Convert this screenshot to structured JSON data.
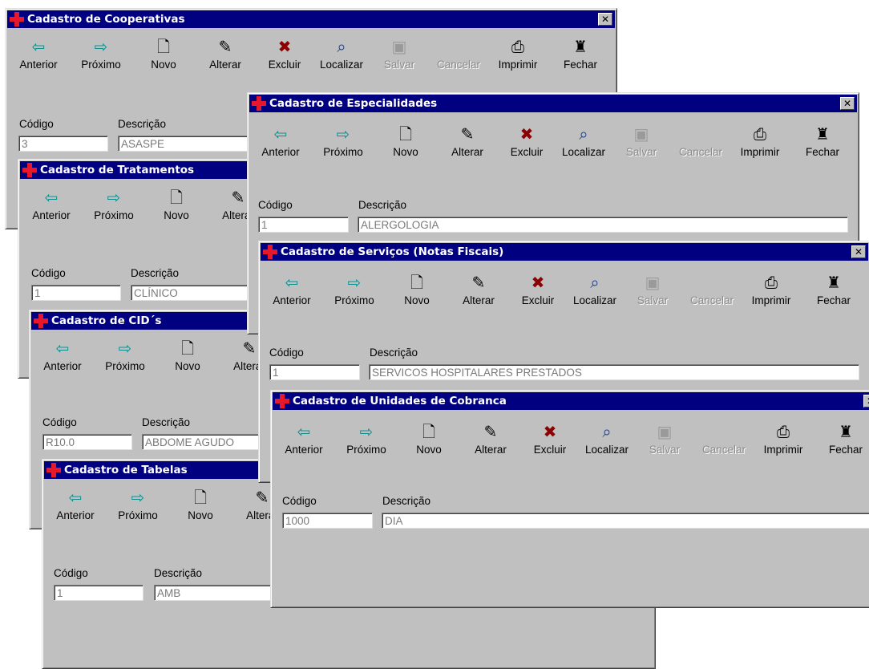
{
  "toolbar_labels": {
    "anterior": "Anterior",
    "proximo": "Próximo",
    "novo": "Novo",
    "alterar": "Alterar",
    "excluir": "Excluir",
    "localizar": "Localizar",
    "salvar": "Salvar",
    "cancelar": "Cancelar",
    "imprimir": "Imprimir",
    "fechar": "Fechar"
  },
  "field_labels": {
    "codigo": "Código",
    "descricao": "Descrição"
  },
  "close_glyph": "✕",
  "icons": {
    "anterior": "arrow-left-icon",
    "proximo": "arrow-right-icon",
    "novo": "new-document-icon",
    "alterar": "edit-icon",
    "excluir": "delete-x-icon",
    "localizar": "find-icon",
    "salvar": "save-disk-icon",
    "imprimir": "printer-icon",
    "fechar": "exit-door-icon"
  },
  "colors": {
    "titlebar": "#000080",
    "window": "#c0c0c0",
    "logo_cross": "#e8182c",
    "nav_arrow": "#0e8f8f"
  },
  "windows": {
    "cooperativas": {
      "title": "Cadastro de Cooperativas",
      "codigo": "3",
      "descricao": "ASASPE"
    },
    "tratamentos": {
      "title": "Cadastro de Tratamentos",
      "codigo": "1",
      "descricao": "CLÍNICO"
    },
    "cids": {
      "title": "Cadastro de CID´s",
      "codigo": "R10.0",
      "descricao": "ABDOME AGUDO"
    },
    "tabelas": {
      "title": "Cadastro de Tabelas",
      "codigo": "1",
      "descricao": "AMB"
    },
    "especialidades": {
      "title": "Cadastro de Especialidades",
      "codigo": "1",
      "descricao": "ALERGOLOGIA"
    },
    "servicos": {
      "title": "Cadastro de Serviços (Notas Fiscais)",
      "codigo": "1",
      "descricao": "SERVICOS HOSPITALARES PRESTADOS"
    },
    "unidades": {
      "title": "Cadastro de Unidades de Cobranca",
      "codigo": "1000",
      "descricao": "DIA"
    }
  }
}
